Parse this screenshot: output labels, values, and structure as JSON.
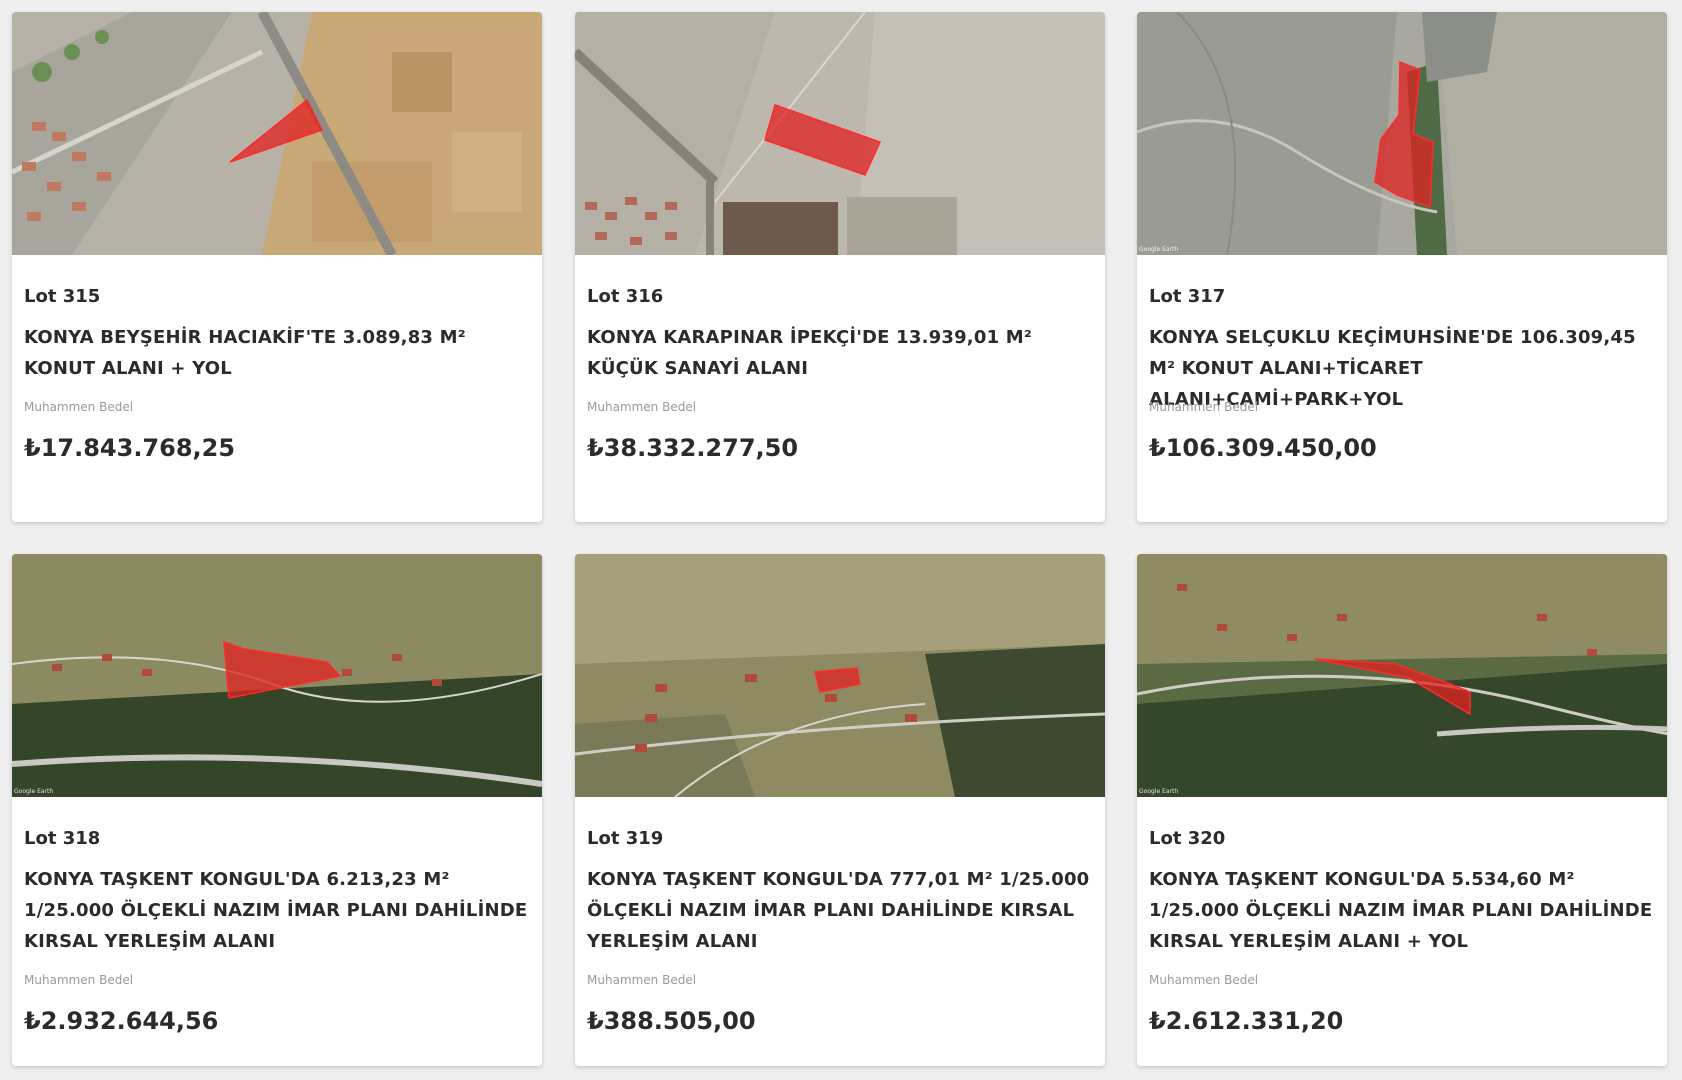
{
  "price_label": "Muhammen Bedel",
  "cards": [
    {
      "lot": "Lot 315",
      "title": "KONYA BEYŞEHİR HACIAKİF'TE 3.089,83 M² KONUT ALANI + YOL",
      "price": "₺17.843.768,25"
    },
    {
      "lot": "Lot 316",
      "title": "KONYA KARAPINAR İPEKÇİ'DE 13.939,01 M² KÜÇÜK SANAYİ ALANI",
      "price": "₺38.332.277,50"
    },
    {
      "lot": "Lot 317",
      "title": "KONYA SELÇUKLU KEÇİMUHSİNE'DE 106.309,45 M² KONUT ALANI+TİCARET ALANI+CAMİ+PARK+YOL",
      "price": "₺106.309.450,00"
    },
    {
      "lot": "Lot 318",
      "title": "KONYA TAŞKENT KONGUL'DA 6.213,23 M² 1/25.000 ÖLÇEKLİ NAZIM İMAR PLANI DAHİLİNDE KIRSAL YERLEŞİM ALANI",
      "price": "₺2.932.644,56"
    },
    {
      "lot": "Lot 319",
      "title": "KONYA TAŞKENT KONGUL'DA 777,01 M² 1/25.000 ÖLÇEKLİ NAZIM İMAR PLANI DAHİLİNDE KIRSAL YERLEŞİM ALANI",
      "price": "₺388.505,00"
    },
    {
      "lot": "Lot 320",
      "title": "KONYA TAŞKENT KONGUL'DA 5.534,60 M² 1/25.000 ÖLÇEKLİ NAZIM İMAR PLANI DAHİLİNDE KIRSAL YERLEŞİM ALANI + YOL",
      "price": "₺2.612.331,20"
    }
  ],
  "colors": {
    "parcel_fill": "#e02020",
    "text": "#2b2b2b",
    "muted": "#9a9a9a",
    "background": "#efefef"
  }
}
